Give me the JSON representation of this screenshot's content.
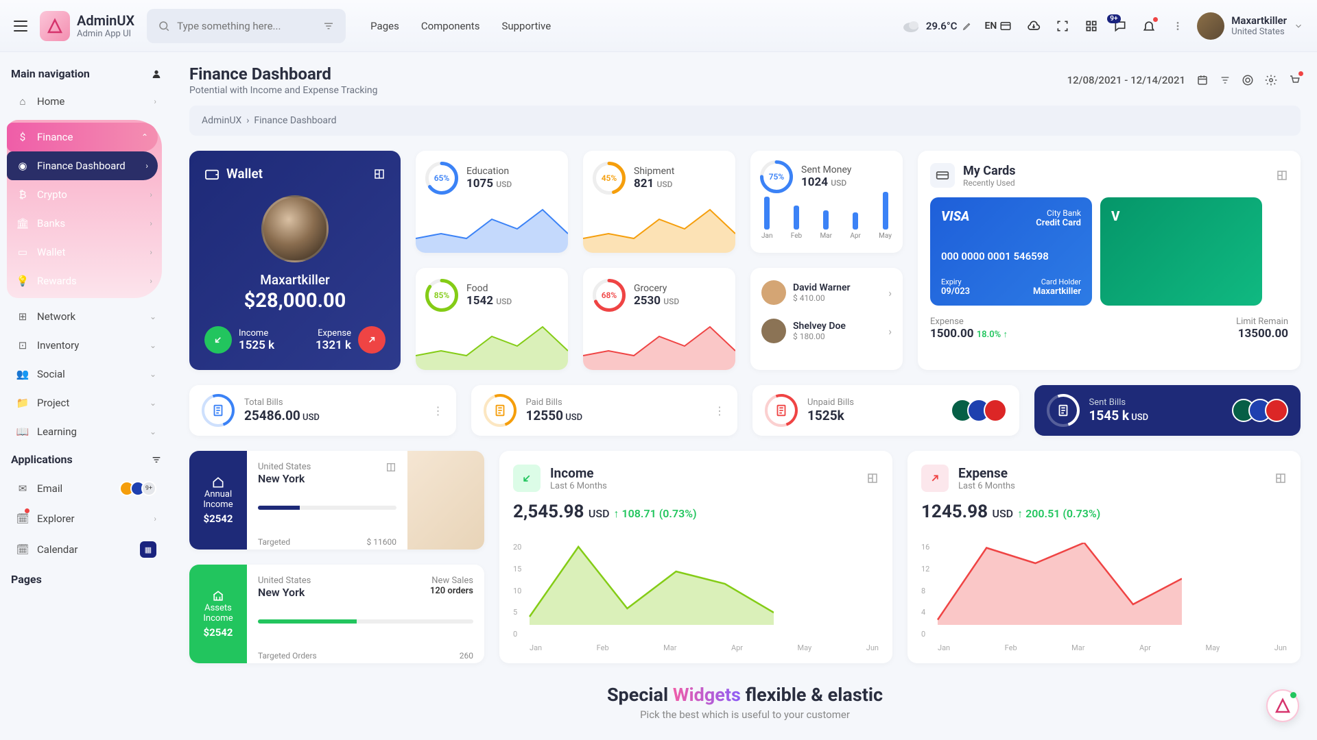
{
  "app": {
    "name": "AdminUX",
    "tagline": "Admin App UI"
  },
  "search": {
    "placeholder": "Type something here..."
  },
  "topnav": [
    "Pages",
    "Components",
    "Supportive"
  ],
  "weather": {
    "temp": "29.6",
    "unit": "°C"
  },
  "lang": "EN",
  "msg_badge": "9+",
  "profile": {
    "name": "Maxartkiller",
    "location": "United States"
  },
  "sidebar": {
    "main_title": "Main navigation",
    "items": [
      {
        "icon": "home",
        "label": "Home"
      },
      {
        "icon": "dollar",
        "label": "Finance",
        "active": true,
        "children": [
          {
            "icon": "gauge",
            "label": "Finance Dashboard",
            "active": true
          },
          {
            "icon": "bitcoin",
            "label": "Crypto"
          },
          {
            "icon": "bank",
            "label": "Banks"
          },
          {
            "icon": "wallet",
            "label": "Wallet"
          },
          {
            "icon": "bulb",
            "label": "Rewards"
          }
        ]
      },
      {
        "icon": "net",
        "label": "Network"
      },
      {
        "icon": "box",
        "label": "Inventory"
      },
      {
        "icon": "users",
        "label": "Social"
      },
      {
        "icon": "folder",
        "label": "Project"
      },
      {
        "icon": "book",
        "label": "Learning"
      }
    ],
    "apps_title": "Applications",
    "apps": [
      {
        "icon": "mail",
        "label": "Email",
        "extra": "9+"
      },
      {
        "icon": "cal",
        "label": "Explorer",
        "dot": true
      },
      {
        "icon": "cal",
        "label": "Calendar",
        "badge": true
      }
    ],
    "pages_title": "Pages"
  },
  "page": {
    "title": "Finance Dashboard",
    "subtitle": "Potential with Income and Expense Tracking"
  },
  "daterange": "12/08/2021 - 12/14/2021",
  "breadcrumb": {
    "root": "AdminUX",
    "current": "Finance Dashboard"
  },
  "wallet": {
    "title": "Wallet",
    "name": "Maxartkiller",
    "amount": "$28,000.00",
    "income": {
      "label": "Income",
      "val": "1525 k"
    },
    "expense": {
      "label": "Expense",
      "val": "1321 k"
    }
  },
  "stats": [
    {
      "pct": 65,
      "label": "Education",
      "val": "1075",
      "cur": "USD",
      "color": "#3b82f6"
    },
    {
      "pct": 45,
      "label": "Shipment",
      "val": "821",
      "cur": "USD",
      "color": "#f59e0b"
    },
    {
      "pct": 85,
      "label": "Food",
      "val": "1542",
      "cur": "USD",
      "color": "#84cc16"
    },
    {
      "pct": 68,
      "label": "Grocery",
      "val": "2530",
      "cur": "USD",
      "color": "#ef4444"
    }
  ],
  "sent": {
    "pct": 75,
    "label": "Sent Money",
    "val": "1024",
    "cur": "USD",
    "color": "#3b82f6"
  },
  "chart_data": {
    "type": "bar",
    "categories": [
      "Jan",
      "Feb",
      "Mar",
      "Apr",
      "May"
    ],
    "values": [
      48,
      35,
      28,
      25,
      55
    ],
    "ylim": [
      0,
      60
    ]
  },
  "people": [
    {
      "name": "David Warner",
      "amt": "$ 410.00"
    },
    {
      "name": "Shelvey Doe",
      "amt": "$ 180.00"
    }
  ],
  "mycards": {
    "title": "My Cards",
    "sub": "Recently Used",
    "cards": [
      {
        "brand": "VISA",
        "bank": "City Bank",
        "type": "Credit Card",
        "num": "000 0000 0001 546598",
        "exp_l": "Expiry",
        "exp_v": "09/023",
        "hold_l": "Card Holder",
        "hold_v": "Maxartkiller",
        "style": "blue"
      },
      {
        "brand": "V",
        "style": "green"
      }
    ],
    "expense": {
      "label": "Expense",
      "val": "1500.00",
      "pct": "18.0%"
    },
    "limit": {
      "label": "Limit Remain",
      "val": "13500.00"
    }
  },
  "bills": [
    {
      "label": "Total Bills",
      "val": "25486.00",
      "cur": "USD",
      "color": "#3b82f6",
      "more": true
    },
    {
      "label": "Paid Bills",
      "val": "12550",
      "cur": "USD",
      "color": "#f59e0b",
      "more": true
    },
    {
      "label": "Unpaid Bills",
      "val": "1525k",
      "cur": "",
      "color": "#ef4444",
      "avatars": true
    },
    {
      "label": "Sent Bills",
      "val": "1545 k",
      "cur": "USD",
      "color": "#fff",
      "dark": true,
      "avatars": true
    }
  ],
  "loc1": {
    "badge1": "Annual",
    "badge2": "Income",
    "badge3": "$2542",
    "country": "United States",
    "city": "New York",
    "target_l": "Targeted",
    "target_v": "$ 11600",
    "progress": 30
  },
  "loc2": {
    "badge1": "Assets",
    "badge2": "Income",
    "badge3": "$2542",
    "country": "United States",
    "city": "New York",
    "sales_l": "New Sales",
    "sales_v": "120 orders",
    "target_l": "Targeted Orders",
    "target_v": "260",
    "progress": 46
  },
  "income": {
    "title": "Income",
    "sub": "Last 6 Months",
    "val": "2,545.98",
    "cur": "USD",
    "delta": "108.71 (0.73%)",
    "chart": {
      "type": "area",
      "x": [
        "Jan",
        "Feb",
        "Mar",
        "Apr",
        "May",
        "Jun"
      ],
      "y": [
        2,
        19,
        4,
        13,
        10,
        3
      ],
      "yticks": [
        0,
        5,
        10,
        15,
        20
      ],
      "color": "#84cc16"
    }
  },
  "expense": {
    "title": "Expense",
    "sub": "Last 6 Months",
    "val": "1245.98",
    "cur": "USD",
    "delta": "200.51 (0.73%)",
    "chart": {
      "type": "area",
      "x": [
        "Jan",
        "Feb",
        "Mar",
        "Apr",
        "May",
        "Jun"
      ],
      "y": [
        1,
        15,
        12,
        16,
        4,
        9
      ],
      "yticks": [
        0,
        4,
        8,
        12,
        16
      ],
      "color": "#ef4444"
    }
  },
  "special": {
    "t1": "Special",
    "t2": "Widgets",
    "t3": "flexible & elastic",
    "sub": "Pick the best which is useful to your customer"
  }
}
